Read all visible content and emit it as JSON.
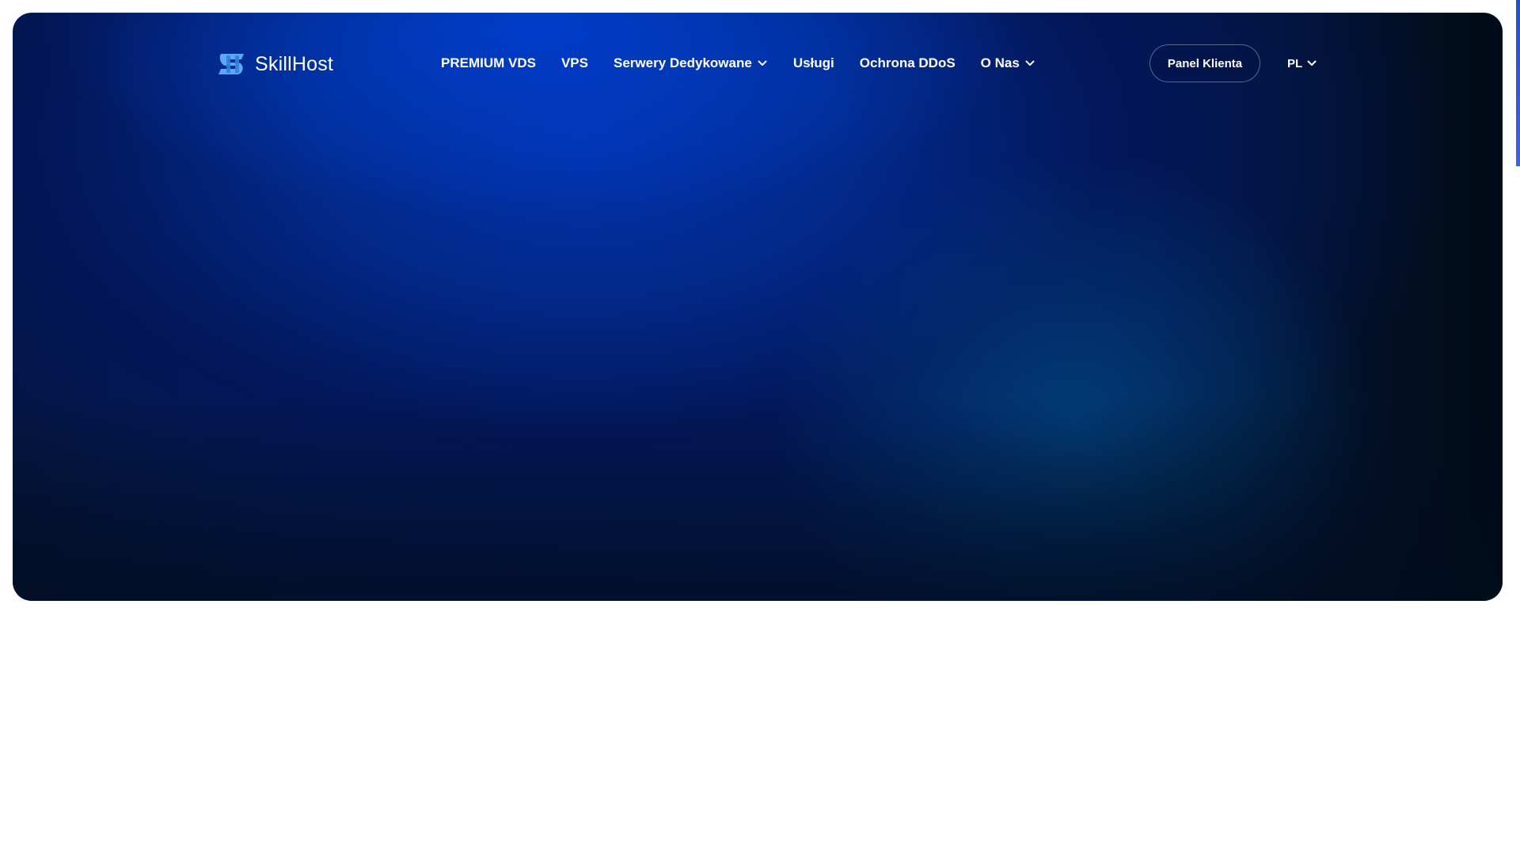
{
  "header": {
    "brand": "SkillHost",
    "nav": [
      {
        "label": "PREMIUM VDS",
        "has_dropdown": false
      },
      {
        "label": "VPS",
        "has_dropdown": false
      },
      {
        "label": "Serwery Dedykowane",
        "has_dropdown": true
      },
      {
        "label": "Usługi",
        "has_dropdown": false
      },
      {
        "label": "Ochrona DDoS",
        "has_dropdown": false
      },
      {
        "label": "O Nas",
        "has_dropdown": true
      }
    ],
    "client_panel_label": "Panel Klienta",
    "language": "PL"
  },
  "icons": {
    "logo": "skillhost-logo-icon",
    "dropdown": "chevron-down-icon"
  },
  "colors": {
    "hero_primary": "#0332ae",
    "hero_dark": "#010a15",
    "logo_accent": "#5aa9f5",
    "text": "#ffffff"
  }
}
